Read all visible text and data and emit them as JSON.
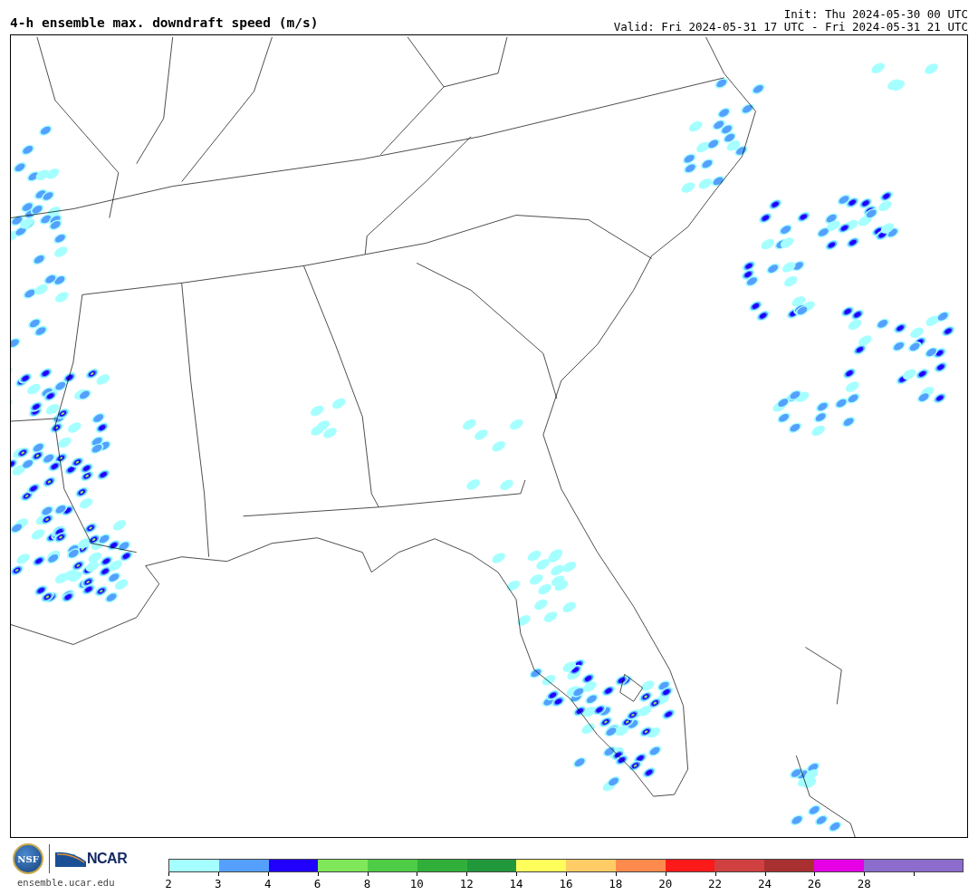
{
  "title": "4-h ensemble max. downdraft speed (m/s)",
  "init": "Init: Thu 2024-05-30 00 UTC",
  "valid": "Valid: Fri 2024-05-31 17 UTC - Fri 2024-05-31 21 UTC",
  "logos": {
    "nsf": "NSF",
    "ncar": "NCAR",
    "url": "ensemble.ucar.edu"
  },
  "colorbar": {
    "bins": [
      {
        "label": "2",
        "color": "#a6ffff"
      },
      {
        "label": "3",
        "color": "#55a0ff"
      },
      {
        "label": "4",
        "color": "#2000ff"
      },
      {
        "label": "6",
        "color": "#80e65a"
      },
      {
        "label": "8",
        "color": "#4ecc46"
      },
      {
        "label": "10",
        "color": "#30b03a"
      },
      {
        "label": "12",
        "color": "#21983c"
      },
      {
        "label": "14",
        "color": "#ffff5c"
      },
      {
        "label": "16",
        "color": "#ffcc66"
      },
      {
        "label": "18",
        "color": "#ff8a4d"
      },
      {
        "label": "20",
        "color": "#ff1a1a"
      },
      {
        "label": "22",
        "color": "#d04040"
      },
      {
        "label": "24",
        "color": "#a83030"
      },
      {
        "label": "26",
        "color": "#e600e6"
      },
      {
        "label": "28",
        "color": "#8c6ccc"
      },
      {
        "color": "#8c6ccc"
      }
    ]
  }
}
